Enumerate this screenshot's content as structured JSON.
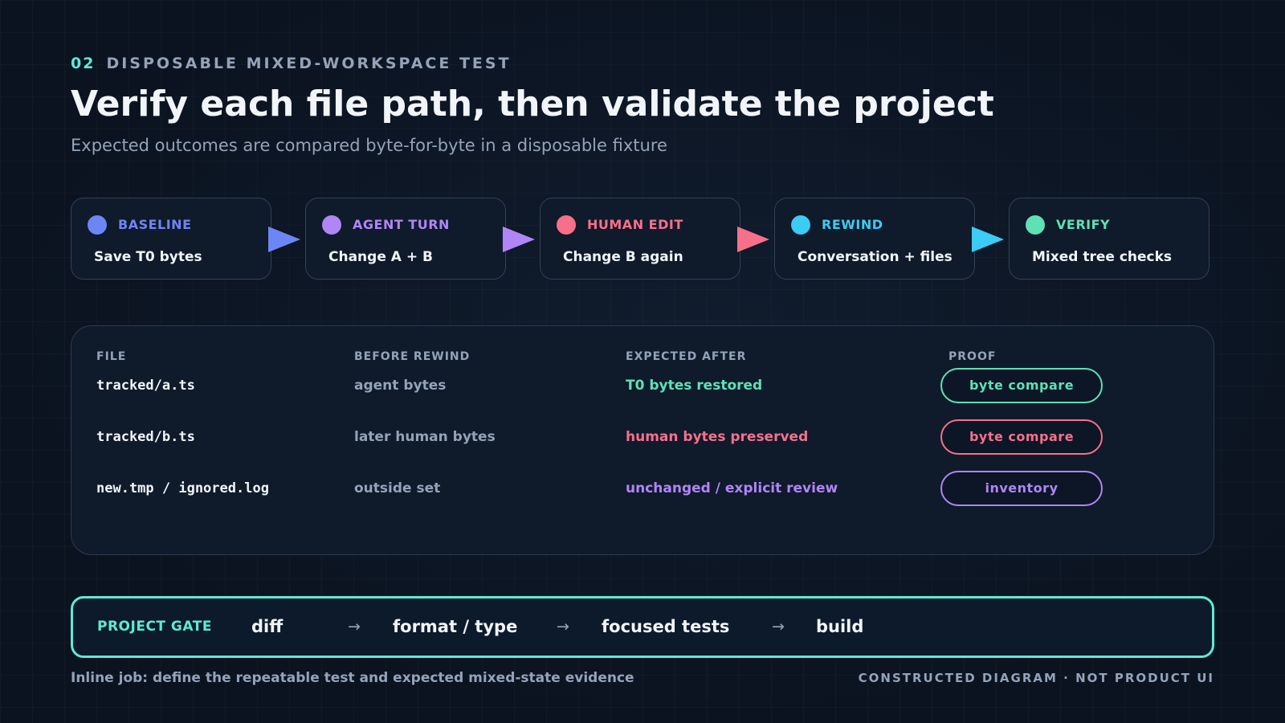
{
  "header": {
    "number": "02",
    "kicker": "DISPOSABLE MIXED-WORKSPACE TEST",
    "title": "Verify each file path, then validate the project",
    "subtitle": "Expected outcomes are compared byte-for-byte in a disposable fixture"
  },
  "colors": {
    "baseline": "#6d86f5",
    "agent": "#b085f5",
    "human": "#f7708a",
    "rewind": "#3ccbf4",
    "verify": "#5ee1b5"
  },
  "pipeline": {
    "stages": [
      {
        "label": "BASELINE",
        "action": "Save T0 bytes",
        "color": "#6d86f5"
      },
      {
        "label": "AGENT TURN",
        "action": "Change A + B",
        "color": "#b085f5"
      },
      {
        "label": "HUMAN EDIT",
        "action": "Change B again",
        "color": "#f7708a"
      },
      {
        "label": "REWIND",
        "action": "Conversation + files",
        "color": "#3ccbf4"
      },
      {
        "label": "VERIFY",
        "action": "Mixed tree checks",
        "color": "#5ee1b5"
      }
    ]
  },
  "table": {
    "headers": {
      "file": "FILE",
      "before": "BEFORE REWIND",
      "after": "EXPECTED AFTER",
      "proof": "PROOF"
    },
    "rows": [
      {
        "file": "tracked/a.ts",
        "before": "agent bytes",
        "after": "T0 bytes restored",
        "proof": "byte compare",
        "color": "#5ee1b5"
      },
      {
        "file": "tracked/b.ts",
        "before": "later human bytes",
        "after": "human bytes preserved",
        "proof": "byte compare",
        "color": "#f7708a"
      },
      {
        "file": "new.tmp / ignored.log",
        "before": "outside set",
        "after": "unchanged / explicit review",
        "proof": "inventory",
        "color": "#b085f5"
      }
    ]
  },
  "gate": {
    "label": "PROJECT GATE",
    "steps": [
      "diff",
      "format / type",
      "focused tests",
      "build"
    ],
    "arrow": "→"
  },
  "footer": {
    "left": "Inline job: define the repeatable test and expected mixed-state evidence",
    "right": "CONSTRUCTED DIAGRAM · NOT PRODUCT UI"
  }
}
